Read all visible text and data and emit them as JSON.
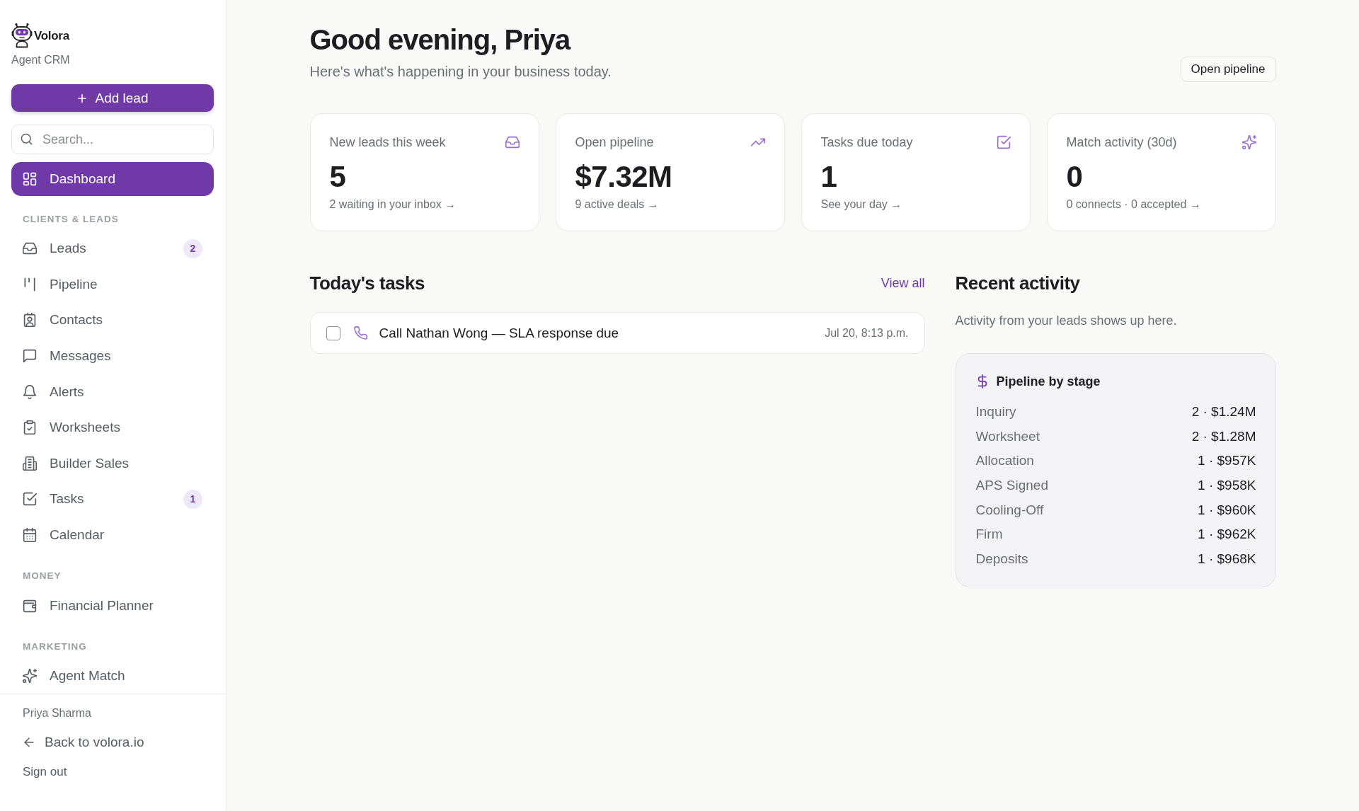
{
  "sidebar": {
    "brand": {
      "name": "Volora",
      "subtitle": "Agent CRM"
    },
    "add_button": "Add lead",
    "search": {
      "placeholder": "Search..."
    },
    "sections": [
      {
        "items": [
          {
            "label": "Dashboard",
            "selected": true
          }
        ]
      },
      {
        "heading": "CLIENTS & LEADS",
        "items": [
          {
            "label": "Leads",
            "selected": false,
            "badge": "2"
          },
          {
            "label": "Pipeline",
            "selected": false
          },
          {
            "label": "Contacts",
            "selected": false
          },
          {
            "label": "Messages",
            "selected": false
          },
          {
            "label": "Alerts",
            "selected": false
          },
          {
            "label": "Worksheets",
            "selected": false
          },
          {
            "label": "Builder Sales",
            "selected": false
          },
          {
            "label": "Tasks",
            "selected": false,
            "badge": "1"
          },
          {
            "label": "Calendar",
            "selected": false
          }
        ]
      },
      {
        "heading": "MONEY",
        "items": [
          {
            "label": "Financial Planner",
            "selected": false
          }
        ]
      },
      {
        "heading": "MARKETING",
        "items": [
          {
            "label": "Agent Match",
            "selected": false
          }
        ]
      }
    ],
    "footer": {
      "user_name": "Priya Sharma",
      "back_link": "Back to volora.io",
      "sign_out": "Sign out"
    }
  },
  "header": {
    "title": "Good evening, Priya",
    "subtitle": "Here's what's happening in your business today.",
    "action": "Open pipeline"
  },
  "stats": [
    {
      "label": "New leads this week",
      "value": "5",
      "detail": "2 waiting in your inbox →"
    },
    {
      "label": "Open pipeline",
      "value": "$7.32M",
      "detail": "9 active deals →"
    },
    {
      "label": "Tasks due today",
      "value": "1",
      "detail": "See your day →"
    },
    {
      "label": "Match activity (30d)",
      "value": "0",
      "detail": "0 connects · 0 accepted →"
    }
  ],
  "tasks": {
    "title": "Today's tasks",
    "link": "View all",
    "items": [
      {
        "title": "Call Nathan Wong — SLA response due",
        "due": "Jul 20, 8:13 p.m.",
        "checked": false
      }
    ]
  },
  "activity": {
    "title": "Recent activity",
    "empty_text": "Activity from your leads shows up here.",
    "pipeline": {
      "title": "Pipeline by stage",
      "stages": [
        {
          "name": "Inquiry",
          "summary": "2 · $1.24M"
        },
        {
          "name": "Worksheet",
          "summary": "2 · $1.28M"
        },
        {
          "name": "Allocation",
          "summary": "1 · $957K"
        },
        {
          "name": "APS Signed",
          "summary": "1 · $958K"
        },
        {
          "name": "Cooling-Off",
          "summary": "1 · $960K"
        },
        {
          "name": "Firm",
          "summary": "1 · $962K"
        },
        {
          "name": "Deposits",
          "summary": "1 · $968K"
        }
      ]
    }
  }
}
